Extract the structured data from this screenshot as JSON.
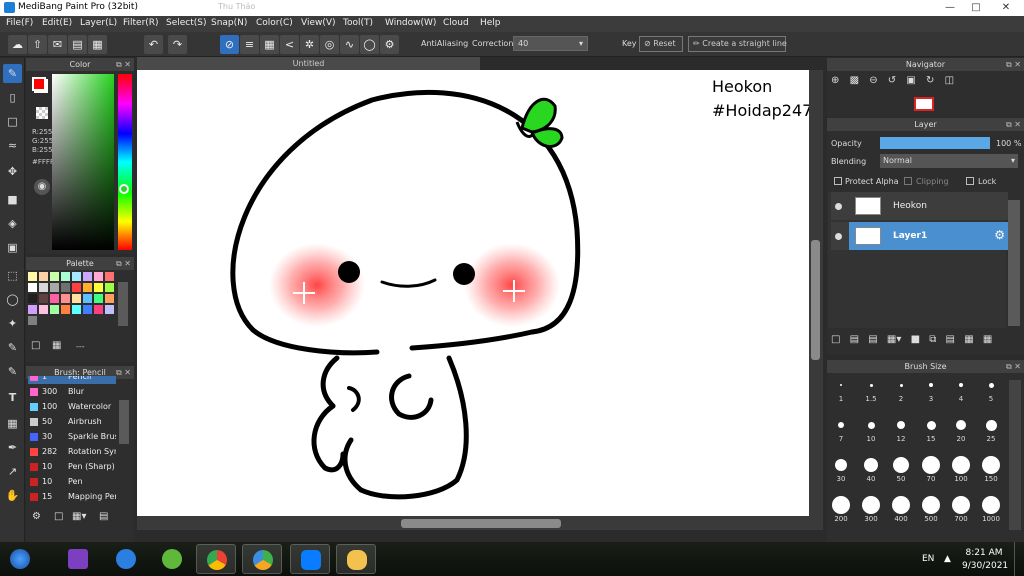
{
  "window": {
    "title": "MediBang Paint Pro (32bit)",
    "ghost_title": "Thu Thảo"
  },
  "menu": [
    "File(F)",
    "Edit(E)",
    "Layer(L)",
    "Filter(R)",
    "Select(S)",
    "Snap(N)",
    "Color(C)",
    "View(V)",
    "Tool(T)",
    "Window(W)",
    "Cloud",
    "Help"
  ],
  "toolbar": {
    "antialiasing_label": "AntiAliasing",
    "correction_label": "Correction",
    "correction_value": "40",
    "key_label": "Key",
    "reset_label": "Reset",
    "straight_line_label": "Create a straight line"
  },
  "color_panel": {
    "title": "Color",
    "r": "R:255",
    "g": "G:255",
    "b": "B:255",
    "hex": "#FFFFFF",
    "fg_color": "#ff0000",
    "bg_color": "#ffffff"
  },
  "palette_panel": {
    "title": "Palette",
    "value": "---",
    "colors": [
      "#fff8a8",
      "#ffd3a8",
      "#c8ffa8",
      "#a8ffd3",
      "#a8e8ff",
      "#c8a8ff",
      "#ffa8d3",
      "#ff7070",
      "#ffffff",
      "#d8d8d8",
      "#a8a8a8",
      "#707070",
      "#ff4040",
      "#ffb030",
      "#ffff40",
      "#a0ff40",
      "#202020",
      "#604040",
      "#ff60a0",
      "#ff9090",
      "#ffe0a0",
      "#60c0ff",
      "#40ff80",
      "#ffa060",
      "#d0a0ff",
      "#ffc0e0",
      "#a0ffa0",
      "#ff8040",
      "#60ffff",
      "#4080ff",
      "#ff4080",
      "#c0c0ff",
      "#808080"
    ]
  },
  "brush_panel": {
    "title": "Brush: Pencil",
    "items": [
      {
        "size": "1",
        "name": "Pencil",
        "color": "#ff66cc"
      },
      {
        "size": "300",
        "name": "Blur",
        "color": "#ff66cc"
      },
      {
        "size": "100",
        "name": "Watercolor",
        "color": "#66ccff"
      },
      {
        "size": "50",
        "name": "Airbrush",
        "color": "#cccccc"
      },
      {
        "size": "30",
        "name": "Sparkle Brush",
        "color": "#4466ff"
      },
      {
        "size": "282",
        "name": "Rotation Sym",
        "color": "#ff4444"
      },
      {
        "size": "10",
        "name": "Pen (Sharp)",
        "color": "#cc2222"
      },
      {
        "size": "10",
        "name": "Pen",
        "color": "#cc2222"
      },
      {
        "size": "15",
        "name": "Mapping Pen",
        "color": "#cc2222"
      }
    ]
  },
  "document": {
    "tab_title": "Untitled"
  },
  "canvas": {
    "text1": "Heokon",
    "text2": "#Hoidap247"
  },
  "navigator": {
    "title": "Navigator"
  },
  "layer_panel": {
    "title": "Layer",
    "opacity_label": "Opacity",
    "opacity_value": "100 %",
    "opacity_level": 1.0,
    "blending_label": "Blending",
    "blending_value": "Normal",
    "protect_alpha_label": "Protect Alpha",
    "clipping_label": "Clipping",
    "lock_label": "Lock",
    "layers": [
      {
        "name": "Heokon"
      },
      {
        "name": "Layer1"
      }
    ]
  },
  "brush_size_panel": {
    "title": "Brush Size",
    "sizes": [
      "1",
      "1.5",
      "2",
      "3",
      "4",
      "5",
      "7",
      "10",
      "12",
      "15",
      "20",
      "25",
      "30",
      "40",
      "50",
      "70",
      "100",
      "150",
      "200",
      "300",
      "400",
      "500",
      "700",
      "1000"
    ]
  },
  "taskbar": {
    "lang": "EN",
    "time": "8:21 AM",
    "date": "9/30/2021"
  }
}
